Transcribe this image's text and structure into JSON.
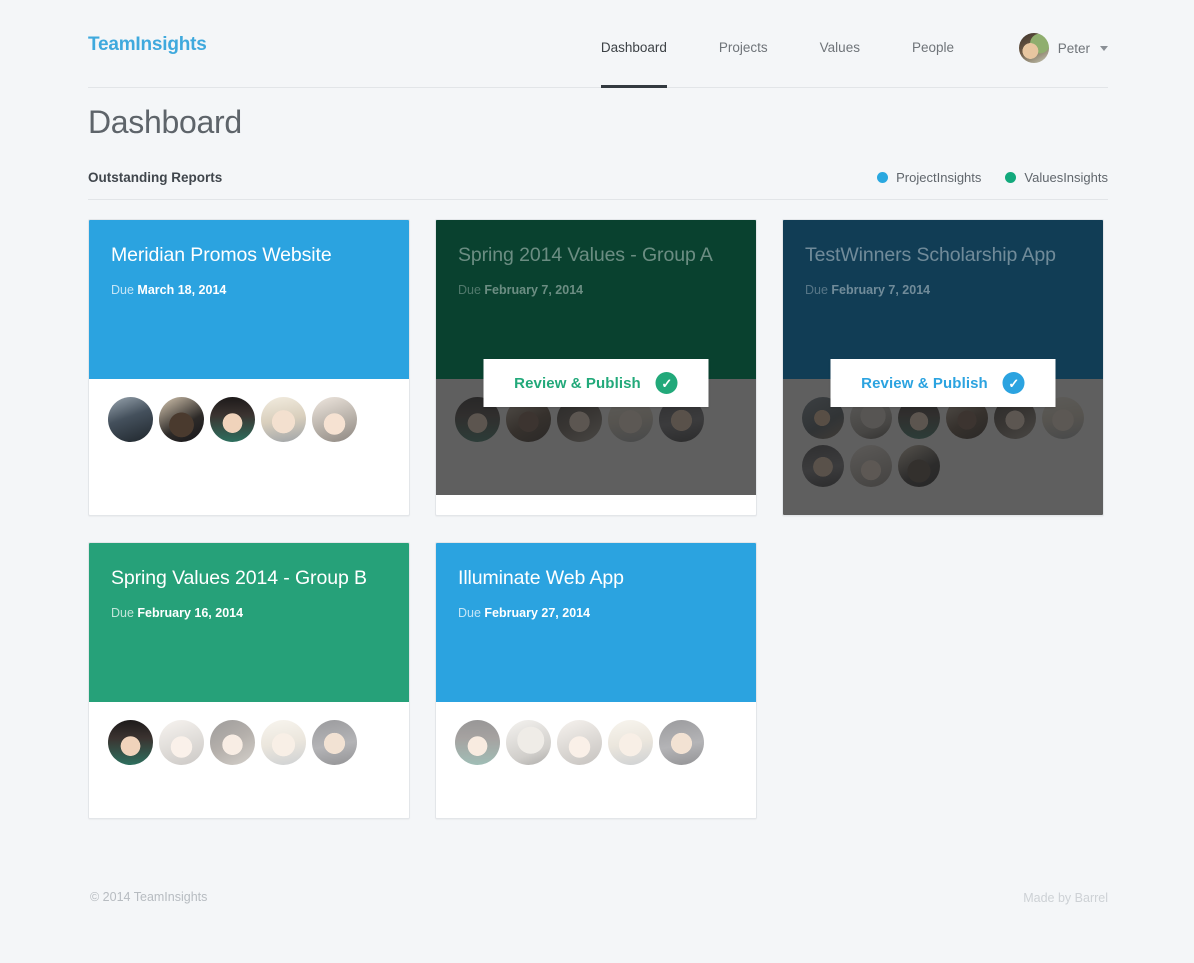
{
  "brand": "TeamInsights",
  "nav": {
    "items": [
      {
        "label": "Dashboard",
        "active": true
      },
      {
        "label": "Projects",
        "active": false
      },
      {
        "label": "Values",
        "active": false
      },
      {
        "label": "People",
        "active": false
      }
    ],
    "user_name": "Peter"
  },
  "page_title": "Dashboard",
  "section": {
    "title": "Outstanding Reports",
    "legend": [
      {
        "label": "ProjectInsights",
        "color": "#29a8e0"
      },
      {
        "label": "ValuesInsights",
        "color": "#12a97c"
      }
    ]
  },
  "cards": [
    {
      "title": "Meridian Promos Website",
      "due_prefix": "Due",
      "due_date": "March 18, 2014",
      "color": "#2ba3e0",
      "type": "ProjectInsights",
      "overlay": false,
      "avatars": 5
    },
    {
      "title": "Spring 2014 Values - Group A",
      "due_prefix": "Due",
      "due_date": "February 7, 2014",
      "color": "#12a97c",
      "type": "ValuesInsights",
      "overlay": true,
      "overlay_style": "green",
      "overlay_color": "#0e3a2c",
      "button_label": "Review & Publish",
      "button_color": "#22a97a",
      "check_icon": "check-circle-icon",
      "avatars": 5
    },
    {
      "title": "TestWinners Scholarship App",
      "due_prefix": "Due",
      "due_date": "February 7, 2014",
      "color": "#2ba3e0",
      "type": "ProjectInsights",
      "overlay": true,
      "overlay_style": "navy",
      "overlay_color": "#163a4d",
      "button_label": "Review & Publish",
      "button_color": "#2ba3e0",
      "check_icon": "check-circle-icon",
      "avatars": 9
    },
    {
      "title": "Spring Values 2014 - Group B",
      "due_prefix": "Due",
      "due_date": "February 16, 2014",
      "color": "#26a179",
      "type": "ValuesInsights",
      "overlay": false,
      "avatars": 5
    },
    {
      "title": "Illuminate Web App",
      "due_prefix": "Due",
      "due_date": "February 27, 2014",
      "color": "#2ba3e0",
      "type": "ProjectInsights",
      "overlay": false,
      "avatars": 5
    }
  ],
  "footer": {
    "copyright": "© 2014 TeamInsights",
    "credit": "Made by Barrel"
  }
}
